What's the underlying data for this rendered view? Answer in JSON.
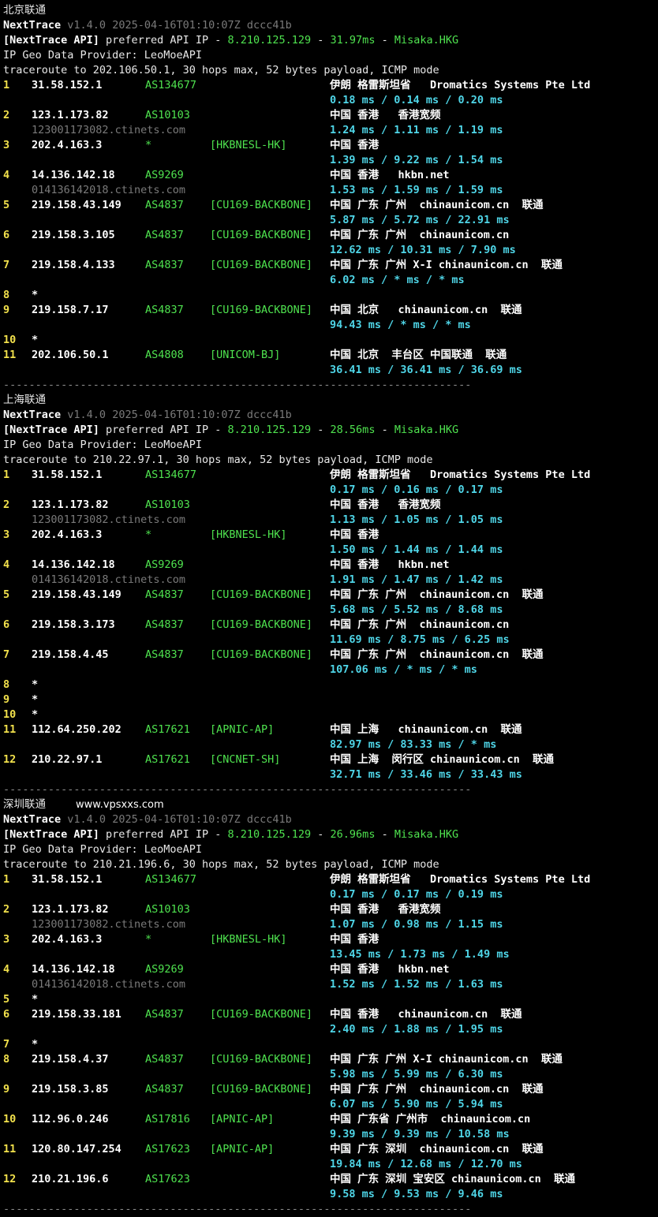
{
  "watermark": "www.vpsxxs.com",
  "blocks": [
    {
      "title": "北京联通",
      "version": "v1.4.0 2025-04-16T01:10:07Z dccc41b",
      "api_ip": "8.210.125.129",
      "api_latency": "31.97ms",
      "api_node": "Misaka.HKG",
      "geo_provider": "IP Geo Data Provider: LeoMoeAPI",
      "traceroute": "traceroute to 202.106.50.1, 30 hops max, 52 bytes payload, ICMP mode",
      "hops": [
        {
          "n": "1",
          "ip": "31.58.152.1",
          "as": "AS134677",
          "tag": "",
          "geo": "伊朗 格雷斯坦省   Dromatics Systems Pte Ltd",
          "rtt": "0.18 ms / 0.14 ms / 0.20 ms"
        },
        {
          "n": "2",
          "ip": "123.1.173.82",
          "as": "AS10103",
          "tag": "",
          "geo": "中国 香港   香港宽频",
          "host": "123001173082.ctinets.com",
          "rtt": "1.24 ms / 1.11 ms / 1.19 ms"
        },
        {
          "n": "3",
          "ip": "202.4.163.3",
          "as": "*",
          "tag": "[HKBNESL-HK]",
          "geo": "中国 香港",
          "rtt": "1.39 ms / 9.22 ms / 1.54 ms"
        },
        {
          "n": "4",
          "ip": "14.136.142.18",
          "as": "AS9269",
          "tag": "",
          "geo": "中国 香港   hkbn.net",
          "host": "014136142018.ctinets.com",
          "rtt": "1.53 ms / 1.59 ms / 1.59 ms"
        },
        {
          "n": "5",
          "ip": "219.158.43.149",
          "as": "AS4837",
          "tag": "[CU169-BACKBONE]",
          "geo": "中国 广东 广州  chinaunicom.cn  联通",
          "rtt": "5.87 ms / 5.72 ms / 22.91 ms"
        },
        {
          "n": "6",
          "ip": "219.158.3.105",
          "as": "AS4837",
          "tag": "[CU169-BACKBONE]",
          "geo": "中国 广东 广州  chinaunicom.cn",
          "rtt": "12.62 ms / 10.31 ms / 7.90 ms"
        },
        {
          "n": "7",
          "ip": "219.158.4.133",
          "as": "AS4837",
          "tag": "[CU169-BACKBONE]",
          "geo": "中国 广东 广州 X-I chinaunicom.cn  联通",
          "rtt": "6.02 ms / * ms / * ms"
        },
        {
          "n": "8",
          "ip": "*",
          "as": "",
          "tag": "",
          "geo": ""
        },
        {
          "n": "9",
          "ip": "219.158.7.17",
          "as": "AS4837",
          "tag": "[CU169-BACKBONE]",
          "geo": "中国 北京   chinaunicom.cn  联通",
          "rtt": "94.43 ms / * ms / * ms"
        },
        {
          "n": "10",
          "ip": "*",
          "as": "",
          "tag": "",
          "geo": ""
        },
        {
          "n": "11",
          "ip": "202.106.50.1",
          "as": "AS4808",
          "tag": "[UNICOM-BJ]",
          "geo": "中国 北京  丰台区 中国联通  联通",
          "rtt": "36.41 ms / 36.41 ms / 36.69 ms"
        }
      ]
    },
    {
      "title": "上海联通",
      "version": "v1.4.0 2025-04-16T01:10:07Z dccc41b",
      "api_ip": "8.210.125.129",
      "api_latency": "28.56ms",
      "api_node": "Misaka.HKG",
      "geo_provider": "IP Geo Data Provider: LeoMoeAPI",
      "traceroute": "traceroute to 210.22.97.1, 30 hops max, 52 bytes payload, ICMP mode",
      "hops": [
        {
          "n": "1",
          "ip": "31.58.152.1",
          "as": "AS134677",
          "tag": "",
          "geo": "伊朗 格雷斯坦省   Dromatics Systems Pte Ltd",
          "rtt": "0.17 ms / 0.16 ms / 0.17 ms"
        },
        {
          "n": "2",
          "ip": "123.1.173.82",
          "as": "AS10103",
          "tag": "",
          "geo": "中国 香港   香港宽频",
          "host": "123001173082.ctinets.com",
          "rtt": "1.13 ms / 1.05 ms / 1.05 ms"
        },
        {
          "n": "3",
          "ip": "202.4.163.3",
          "as": "*",
          "tag": "[HKBNESL-HK]",
          "geo": "中国 香港",
          "rtt": "1.50 ms / 1.44 ms / 1.44 ms"
        },
        {
          "n": "4",
          "ip": "14.136.142.18",
          "as": "AS9269",
          "tag": "",
          "geo": "中国 香港   hkbn.net",
          "host": "014136142018.ctinets.com",
          "rtt": "1.91 ms / 1.47 ms / 1.42 ms"
        },
        {
          "n": "5",
          "ip": "219.158.43.149",
          "as": "AS4837",
          "tag": "[CU169-BACKBONE]",
          "geo": "中国 广东 广州  chinaunicom.cn  联通",
          "rtt": "5.68 ms / 5.52 ms / 8.68 ms"
        },
        {
          "n": "6",
          "ip": "219.158.3.173",
          "as": "AS4837",
          "tag": "[CU169-BACKBONE]",
          "geo": "中国 广东 广州  chinaunicom.cn",
          "rtt": "11.69 ms / 8.75 ms / 6.25 ms"
        },
        {
          "n": "7",
          "ip": "219.158.4.45",
          "as": "AS4837",
          "tag": "[CU169-BACKBONE]",
          "geo": "中国 广东 广州  chinaunicom.cn  联通",
          "rtt": "107.06 ms / * ms / * ms"
        },
        {
          "n": "8",
          "ip": "*",
          "as": "",
          "tag": "",
          "geo": ""
        },
        {
          "n": "9",
          "ip": "*",
          "as": "",
          "tag": "",
          "geo": ""
        },
        {
          "n": "10",
          "ip": "*",
          "as": "",
          "tag": "",
          "geo": ""
        },
        {
          "n": "11",
          "ip": "112.64.250.202",
          "as": "AS17621",
          "tag": "[APNIC-AP]",
          "geo": "中国 上海   chinaunicom.cn  联通",
          "rtt": "82.97 ms / 83.33 ms / * ms"
        },
        {
          "n": "12",
          "ip": "210.22.97.1",
          "as": "AS17621",
          "tag": "[CNCNET-SH]",
          "geo": "中国 上海  闵行区 chinaunicom.cn  联通",
          "rtt": "32.71 ms / 33.46 ms / 33.43 ms"
        }
      ]
    },
    {
      "title": "深圳联通",
      "version": "v1.4.0 2025-04-16T01:10:07Z dccc41b",
      "api_ip": "8.210.125.129",
      "api_latency": "26.96ms",
      "api_node": "Misaka.HKG",
      "geo_provider": "IP Geo Data Provider: LeoMoeAPI",
      "traceroute": "traceroute to 210.21.196.6, 30 hops max, 52 bytes payload, ICMP mode",
      "hops": [
        {
          "n": "1",
          "ip": "31.58.152.1",
          "as": "AS134677",
          "tag": "",
          "geo": "伊朗 格雷斯坦省   Dromatics Systems Pte Ltd",
          "rtt": "0.17 ms / 0.17 ms / 0.19 ms"
        },
        {
          "n": "2",
          "ip": "123.1.173.82",
          "as": "AS10103",
          "tag": "",
          "geo": "中国 香港   香港宽频",
          "host": "123001173082.ctinets.com",
          "rtt": "1.07 ms / 0.98 ms / 1.15 ms"
        },
        {
          "n": "3",
          "ip": "202.4.163.3",
          "as": "*",
          "tag": "[HKBNESL-HK]",
          "geo": "中国 香港",
          "rtt": "13.45 ms / 1.73 ms / 1.49 ms"
        },
        {
          "n": "4",
          "ip": "14.136.142.18",
          "as": "AS9269",
          "tag": "",
          "geo": "中国 香港   hkbn.net",
          "host": "014136142018.ctinets.com",
          "rtt": "1.52 ms / 1.52 ms / 1.63 ms"
        },
        {
          "n": "5",
          "ip": "*",
          "as": "",
          "tag": "",
          "geo": ""
        },
        {
          "n": "6",
          "ip": "219.158.33.181",
          "as": "AS4837",
          "tag": "[CU169-BACKBONE]",
          "geo": "中国 香港   chinaunicom.cn  联通",
          "rtt": "2.40 ms / 1.88 ms / 1.95 ms"
        },
        {
          "n": "7",
          "ip": "*",
          "as": "",
          "tag": "",
          "geo": ""
        },
        {
          "n": "8",
          "ip": "219.158.4.37",
          "as": "AS4837",
          "tag": "[CU169-BACKBONE]",
          "geo": "中国 广东 广州 X-I chinaunicom.cn  联通",
          "rtt": "5.98 ms / 5.99 ms / 6.30 ms"
        },
        {
          "n": "9",
          "ip": "219.158.3.85",
          "as": "AS4837",
          "tag": "[CU169-BACKBONE]",
          "geo": "中国 广东 广州  chinaunicom.cn  联通",
          "rtt": "6.07 ms / 5.90 ms / 5.94 ms"
        },
        {
          "n": "10",
          "ip": "112.96.0.246",
          "as": "AS17816",
          "tag": "[APNIC-AP]",
          "geo": "中国 广东省 广州市  chinaunicom.cn",
          "rtt": "9.39 ms / 9.39 ms / 10.58 ms"
        },
        {
          "n": "11",
          "ip": "120.80.147.254",
          "as": "AS17623",
          "tag": "[APNIC-AP]",
          "geo": "中国 广东 深圳  chinaunicom.cn  联通",
          "rtt": "19.84 ms / 12.68 ms / 12.70 ms"
        },
        {
          "n": "12",
          "ip": "210.21.196.6",
          "as": "AS17623",
          "tag": "",
          "geo": "中国 广东 深圳 宝安区 chinaunicom.cn  联通",
          "rtt": "9.58 ms / 9.53 ms / 9.46 ms"
        }
      ]
    }
  ],
  "labels": {
    "nexttrace": "NextTrace",
    "api_prefix": "[NextTrace API]",
    "api_mid": " preferred API IP - ",
    "dash": " - "
  },
  "separator": "-------------------------------------------------------------------------",
  "colors": {
    "background": "#000000",
    "hop_number": "#f2e14c",
    "asn": "#4fe34f",
    "latency": "#4fd6e8",
    "hostname": "#7a7a7a"
  }
}
